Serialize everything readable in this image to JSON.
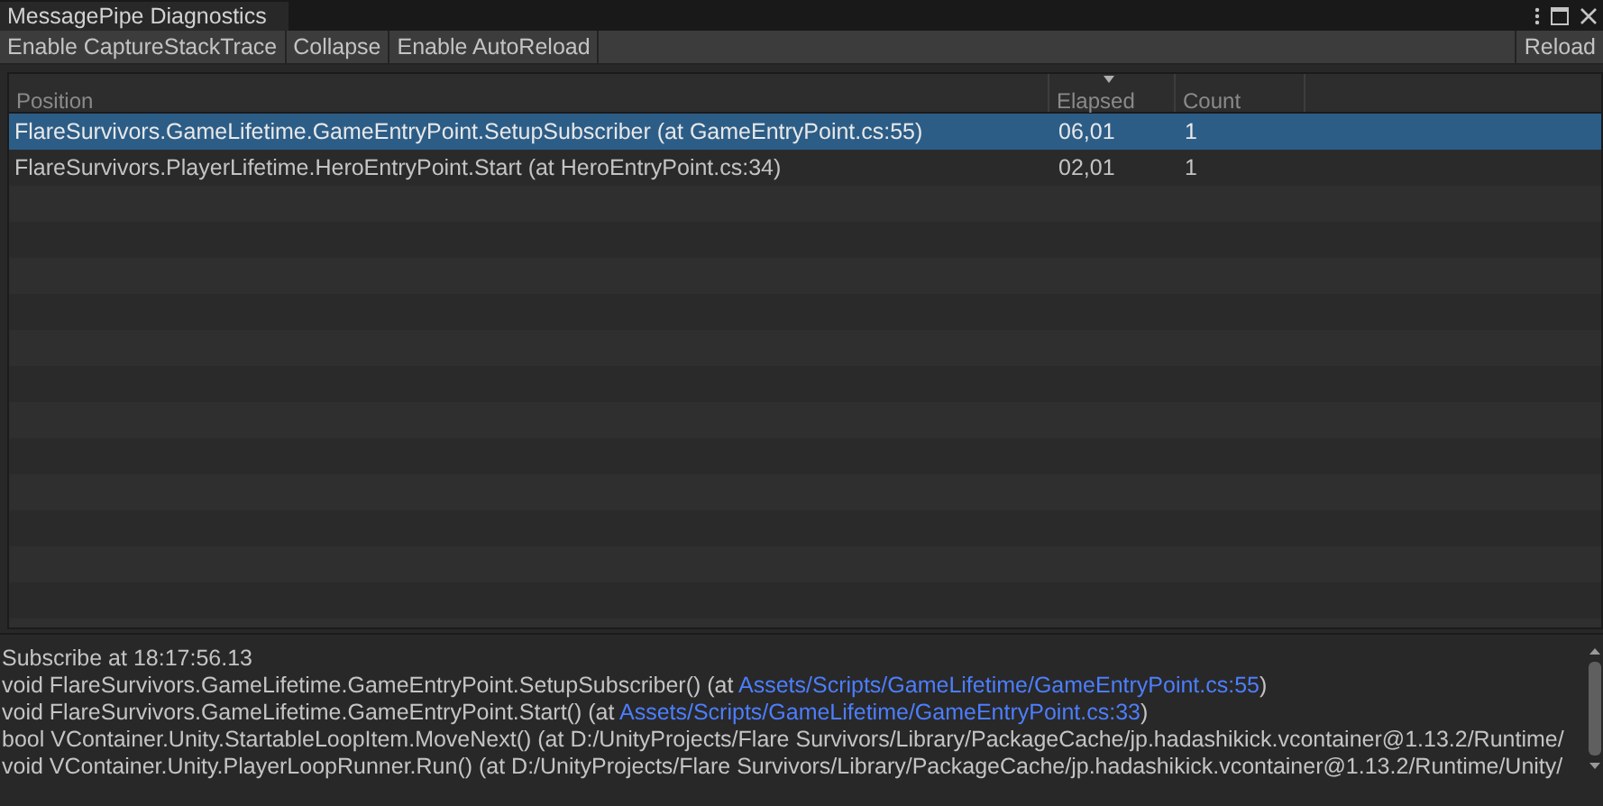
{
  "window": {
    "title": "MessagePipe Diagnostics"
  },
  "toolbar": {
    "buttons": [
      {
        "label": "Enable CaptureStackTrace"
      },
      {
        "label": "Collapse"
      },
      {
        "label": "Enable AutoReload"
      }
    ],
    "right_button": {
      "label": "Reload"
    }
  },
  "table": {
    "columns": [
      {
        "label": "Position",
        "sorted": false
      },
      {
        "label": "Elapsed",
        "sorted": true
      },
      {
        "label": "Count",
        "sorted": false
      }
    ],
    "rows": [
      {
        "cells": [
          "FlareSurvivors.GameLifetime.GameEntryPoint.SetupSubscriber (at GameEntryPoint.cs:55)",
          "06,01",
          "1"
        ],
        "selected": true
      },
      {
        "cells": [
          "FlareSurvivors.PlayerLifetime.HeroEntryPoint.Start (at HeroEntryPoint.cs:34)",
          "02,01",
          "1"
        ],
        "selected": false
      }
    ]
  },
  "details": {
    "heading": "Subscribe at 18:17:56.13",
    "lines": [
      {
        "text": "void FlareSurvivors.GameLifetime.GameEntryPoint.SetupSubscriber() (at ",
        "link": "Assets/Scripts/GameLifetime/GameEntryPoint.cs:55",
        "suffix": ")"
      },
      {
        "text": "void FlareSurvivors.GameLifetime.GameEntryPoint.Start() (at ",
        "link": "Assets/Scripts/GameLifetime/GameEntryPoint.cs:33",
        "suffix": ")"
      },
      {
        "text": "bool VContainer.Unity.StartableLoopItem.MoveNext() (at D:/UnityProjects/Flare Survivors/Library/PackageCache/jp.hadashikick.vcontainer@1.13.2/Runtime/"
      },
      {
        "text": "void VContainer.Unity.PlayerLoopRunner.Run() (at D:/UnityProjects/Flare Survivors/Library/PackageCache/jp.hadashikick.vcontainer@1.13.2/Runtime/Unity/"
      }
    ]
  }
}
